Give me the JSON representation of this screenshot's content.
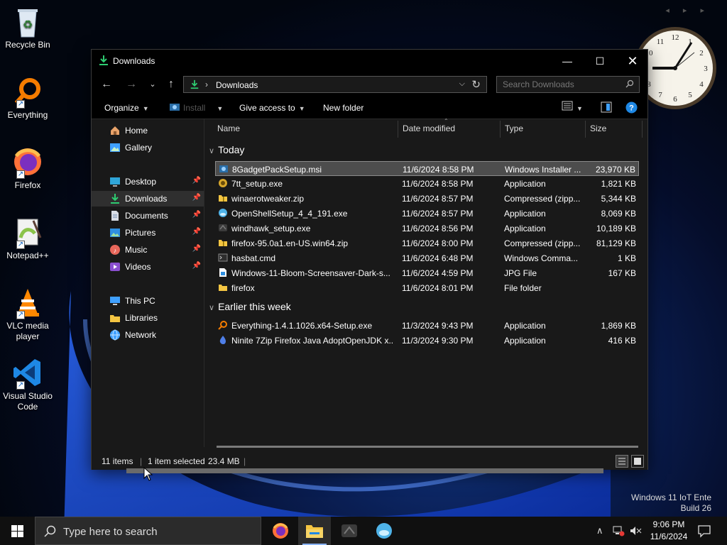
{
  "desktop": {
    "icons": [
      {
        "label": "Recycle Bin"
      },
      {
        "label": "Everything"
      },
      {
        "label": "Firefox"
      },
      {
        "label": "Notepad++"
      },
      {
        "label": "VLC media player"
      },
      {
        "label": "Visual Studio Code"
      }
    ],
    "watermark": {
      "line1": "Windows 11 IoT Ente",
      "line2": "Build 26"
    }
  },
  "window": {
    "title": "Downloads",
    "address": {
      "path": "Downloads"
    },
    "search": {
      "placeholder": "Search Downloads"
    },
    "toolbar": {
      "organize": "Organize",
      "install": "Install",
      "give_access": "Give access to",
      "new_folder": "New folder"
    },
    "nav_pane": {
      "items": [
        {
          "label": "Home",
          "icon": "home-icon"
        },
        {
          "label": "Gallery",
          "icon": "gallery-icon"
        },
        {
          "label": "Desktop",
          "icon": "desktop-icon",
          "pinned": true
        },
        {
          "label": "Downloads",
          "icon": "downloads-icon",
          "pinned": true,
          "selected": true
        },
        {
          "label": "Documents",
          "icon": "documents-icon",
          "pinned": true
        },
        {
          "label": "Pictures",
          "icon": "pictures-icon",
          "pinned": true
        },
        {
          "label": "Music",
          "icon": "music-icon",
          "pinned": true
        },
        {
          "label": "Videos",
          "icon": "videos-icon",
          "pinned": true
        },
        {
          "label": "This PC",
          "icon": "this-pc-icon"
        },
        {
          "label": "Libraries",
          "icon": "libraries-icon"
        },
        {
          "label": "Network",
          "icon": "network-icon"
        }
      ]
    },
    "columns": {
      "name": "Name",
      "date": "Date modified",
      "type": "Type",
      "size": "Size"
    },
    "groups": [
      {
        "label": "Today",
        "files": [
          {
            "name": "8GadgetPackSetup.msi",
            "date": "11/6/2024 8:58 PM",
            "type": "Windows Installer ...",
            "size": "23,970 KB",
            "icon": "msi-installer-icon",
            "selected": true
          },
          {
            "name": "7tt_setup.exe",
            "date": "11/6/2024 8:58 PM",
            "type": "Application",
            "size": "1,821 KB",
            "icon": "app-7tt-icon"
          },
          {
            "name": "winaerotweaker.zip",
            "date": "11/6/2024 8:57 PM",
            "type": "Compressed (zipp...",
            "size": "5,344 KB",
            "icon": "zip-folder-icon"
          },
          {
            "name": "OpenShellSetup_4_4_191.exe",
            "date": "11/6/2024 8:57 PM",
            "type": "Application",
            "size": "8,069 KB",
            "icon": "openshell-icon"
          },
          {
            "name": "windhawk_setup.exe",
            "date": "11/6/2024 8:56 PM",
            "type": "Application",
            "size": "10,189 KB",
            "icon": "windhawk-icon"
          },
          {
            "name": "firefox-95.0a1.en-US.win64.zip",
            "date": "11/6/2024 8:00 PM",
            "type": "Compressed (zipp...",
            "size": "81,129 KB",
            "icon": "zip-folder-icon"
          },
          {
            "name": "hasbat.cmd",
            "date": "11/6/2024 6:48 PM",
            "type": "Windows Comma...",
            "size": "1 KB",
            "icon": "cmd-file-icon"
          },
          {
            "name": "Windows-11-Bloom-Screensaver-Dark-s...",
            "date": "11/6/2024 4:59 PM",
            "type": "JPG File",
            "size": "167 KB",
            "icon": "jpg-file-icon"
          },
          {
            "name": "firefox",
            "date": "11/6/2024 8:01 PM",
            "type": "File folder",
            "size": "",
            "icon": "folder-icon"
          }
        ]
      },
      {
        "label": "Earlier this week",
        "files": [
          {
            "name": "Everything-1.4.1.1026.x64-Setup.exe",
            "date": "11/3/2024 9:43 PM",
            "type": "Application",
            "size": "1,869 KB",
            "icon": "everything-icon"
          },
          {
            "name": "Ninite 7Zip Firefox Java AdoptOpenJDK x...",
            "date": "11/3/2024 9:30 PM",
            "type": "Application",
            "size": "416 KB",
            "icon": "ninite-icon"
          }
        ]
      }
    ],
    "status": {
      "count": "11 items",
      "selected": "1 item selected",
      "size": "23.4 MB"
    }
  },
  "taskbar": {
    "search_placeholder": "Type here to search",
    "time": "9:06 PM",
    "date": "11/6/2024"
  },
  "colors": {
    "accent": "#1e88e5",
    "selection": "#4d4d4d",
    "folder": "#f4c542"
  }
}
